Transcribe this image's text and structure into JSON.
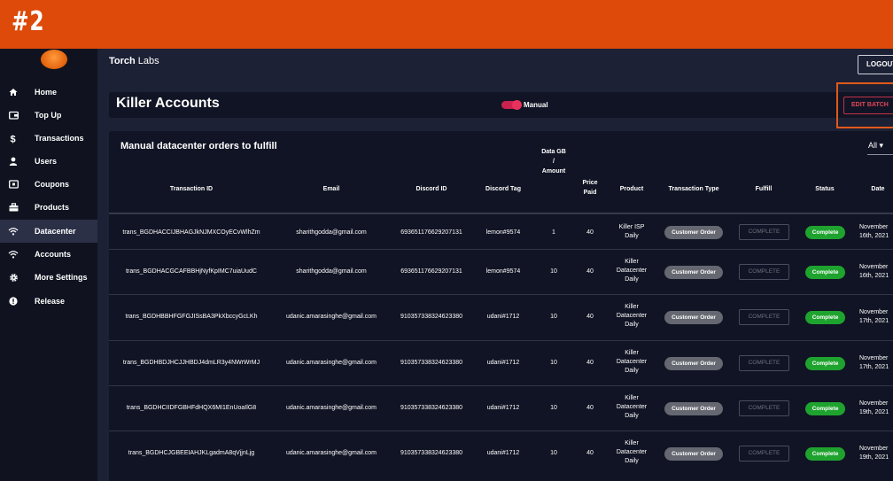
{
  "banner": {
    "number": "#2"
  },
  "app": {
    "title_bold": "Torch",
    "title_rest": " Labs",
    "logout_label": "LOGOUT"
  },
  "sidebar": {
    "items": [
      {
        "label": "Home",
        "icon": "home-icon"
      },
      {
        "label": "Top Up",
        "icon": "wallet-icon"
      },
      {
        "label": "Transactions",
        "icon": "dollar-icon"
      },
      {
        "label": "Users",
        "icon": "user-icon"
      },
      {
        "label": "Coupons",
        "icon": "coupon-icon"
      },
      {
        "label": "Products",
        "icon": "briefcase-icon"
      },
      {
        "label": "Datacenter",
        "icon": "wifi-icon",
        "active": true
      },
      {
        "label": "Accounts",
        "icon": "wifi-icon"
      },
      {
        "label": "More Settings",
        "icon": "gear-icon"
      },
      {
        "label": "Release",
        "icon": "info-icon"
      }
    ]
  },
  "panel": {
    "title": "Killer Accounts",
    "toggle_label": "Manual",
    "toggle_on": true,
    "edit_batch_label": "EDIT BATCH"
  },
  "table": {
    "title": "Manual datacenter orders to fulfill",
    "filter": "All",
    "columns": {
      "transaction_id": "Transaction ID",
      "email": "Email",
      "discord_id": "Discord ID",
      "discord_tag": "Discord Tag",
      "data_gb_1": "Data GB",
      "data_gb_2": "/",
      "data_gb_3": "Amount",
      "price_1": "Price",
      "price_2": "Paid",
      "product": "Product",
      "transaction_type": "Transaction Type",
      "fulfill": "Fulfill",
      "status": "Status",
      "date": "Date"
    },
    "rows": [
      {
        "transaction_id": "trans_BGDHACCIJBHAGJkNJMXCOyECvWlhZm",
        "email": "sharithgodda@gmail.com",
        "discord_id": "693651176629207131",
        "discord_tag": "lemon#9574",
        "data_gb": "1",
        "price": "40",
        "product": [
          "Killer ISP",
          "Daily"
        ],
        "transaction_type": "Customer Order",
        "fulfill": "COMPLETE",
        "status": "Complete",
        "date": [
          "November",
          "16th, 2021"
        ]
      },
      {
        "transaction_id": "trans_BGDHACGCAFBBHjNyfKpIMC7uiaUudC",
        "email": "sharithgodda@gmail.com",
        "discord_id": "693651176629207131",
        "discord_tag": "lemon#9574",
        "data_gb": "10",
        "price": "40",
        "product": [
          "Killer",
          "Datacenter",
          "Daily"
        ],
        "transaction_type": "Customer Order",
        "fulfill": "COMPLETE",
        "status": "Complete",
        "date": [
          "November",
          "16th, 2021"
        ]
      },
      {
        "transaction_id": "trans_BGDHBBHFGFGJISsBA3PkXbccyGcLKh",
        "email": "udanic.amarasinghe@gmail.com",
        "discord_id": "910357338324623380",
        "discord_tag": "udani#1712",
        "data_gb": "10",
        "price": "40",
        "product": [
          "Killer",
          "Datacenter",
          "Daily"
        ],
        "transaction_type": "Customer Order",
        "fulfill": "COMPLETE",
        "status": "Complete",
        "date": [
          "November",
          "17th, 2021"
        ]
      },
      {
        "transaction_id": "trans_BGDHBDJHCJJHBDJ4dmLR3y4NWrWrMJ",
        "email": "udanic.amarasinghe@gmail.com",
        "discord_id": "910357338324623380",
        "discord_tag": "udani#1712",
        "data_gb": "10",
        "price": "40",
        "product": [
          "Killer",
          "Datacenter",
          "Daily"
        ],
        "transaction_type": "Customer Order",
        "fulfill": "COMPLETE",
        "status": "Complete",
        "date": [
          "November",
          "17th, 2021"
        ]
      },
      {
        "transaction_id": "trans_BGDHCIIDFGBHFdHQX6MI1EnUoaIlG8",
        "email": "udanic.amarasinghe@gmail.com",
        "discord_id": "910357338324623380",
        "discord_tag": "udani#1712",
        "data_gb": "10",
        "price": "40",
        "product": [
          "Killer",
          "Datacenter",
          "Daily"
        ],
        "transaction_type": "Customer Order",
        "fulfill": "COMPLETE",
        "status": "Complete",
        "date": [
          "November",
          "19th, 2021"
        ]
      },
      {
        "transaction_id": "trans_BGDHCJGBEEIAHJKLgadmA8qVjjnLjg",
        "email": "udanic.amarasinghe@gmail.com",
        "discord_id": "910357338324623380",
        "discord_tag": "udani#1712",
        "data_gb": "10",
        "price": "40",
        "product": [
          "Killer",
          "Datacenter",
          "Daily"
        ],
        "transaction_type": "Customer Order",
        "fulfill": "COMPLETE",
        "status": "Complete",
        "date": [
          "November",
          "19th, 2021"
        ]
      }
    ]
  },
  "colors": {
    "banner": "#dd4a0a",
    "sidebar": "#10131f",
    "background": "#1d2135",
    "panel": "#111424",
    "accent_pink": "#e9315d",
    "status_green": "#1fa32f",
    "type_gray": "#656870",
    "highlight_orange": "#e05a1a"
  }
}
